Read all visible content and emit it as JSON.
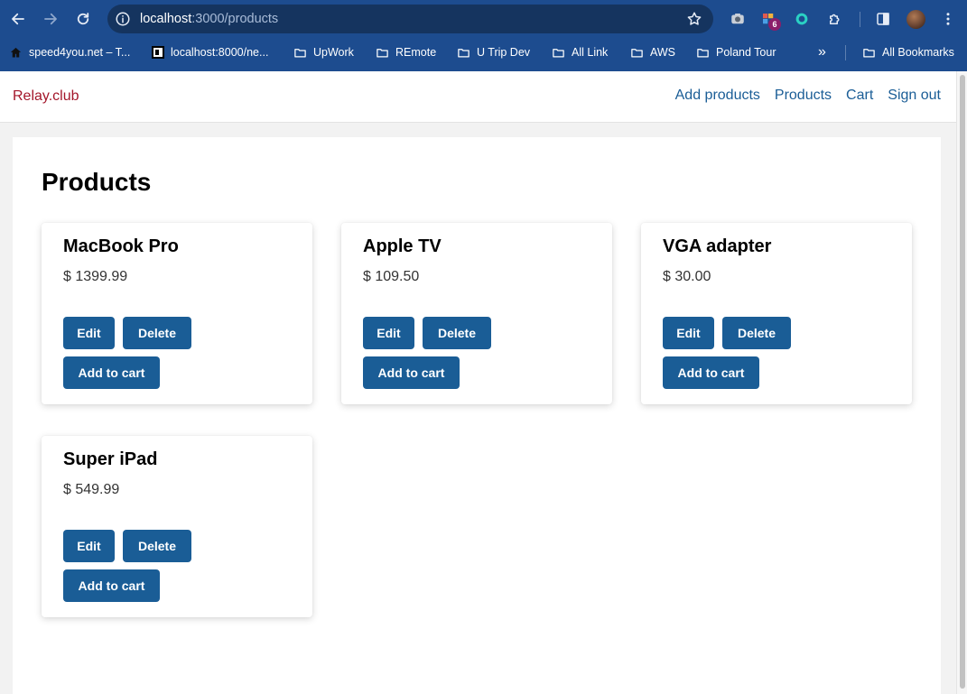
{
  "browser": {
    "url_host": "localhost",
    "url_path": ":3000/products",
    "badge_count": "6",
    "bookmarks": [
      {
        "label": "speed4you.net – T...",
        "icon": "home-icon"
      },
      {
        "label": "localhost:8000/ne...",
        "icon": "favicon-square"
      },
      {
        "label": "UpWork",
        "icon": "folder-icon"
      },
      {
        "label": "REmote",
        "icon": "folder-icon"
      },
      {
        "label": "U Trip Dev",
        "icon": "folder-icon"
      },
      {
        "label": "All Link",
        "icon": "folder-icon"
      },
      {
        "label": "AWS",
        "icon": "folder-icon"
      },
      {
        "label": "Poland Tour",
        "icon": "folder-icon"
      },
      {
        "label": "All Bookmarks",
        "icon": "folder-icon"
      }
    ],
    "overflow_label": "»"
  },
  "header": {
    "brand": "Relay.club",
    "nav": [
      "Add products",
      "Products",
      "Cart",
      "Sign out"
    ]
  },
  "main": {
    "title": "Products",
    "products": [
      {
        "name": "MacBook Pro",
        "price": "$ 1399.99"
      },
      {
        "name": "Apple TV",
        "price": "$ 109.50"
      },
      {
        "name": "VGA adapter",
        "price": "$ 30.00"
      },
      {
        "name": "Super iPad",
        "price": "$ 549.99"
      }
    ],
    "buttons": {
      "edit": "Edit",
      "delete": "Delete",
      "add_to_cart": "Add to cart"
    }
  },
  "colors": {
    "chrome": "#1d4c8f",
    "brand": "#a3162a",
    "primary": "#1a5d96"
  }
}
